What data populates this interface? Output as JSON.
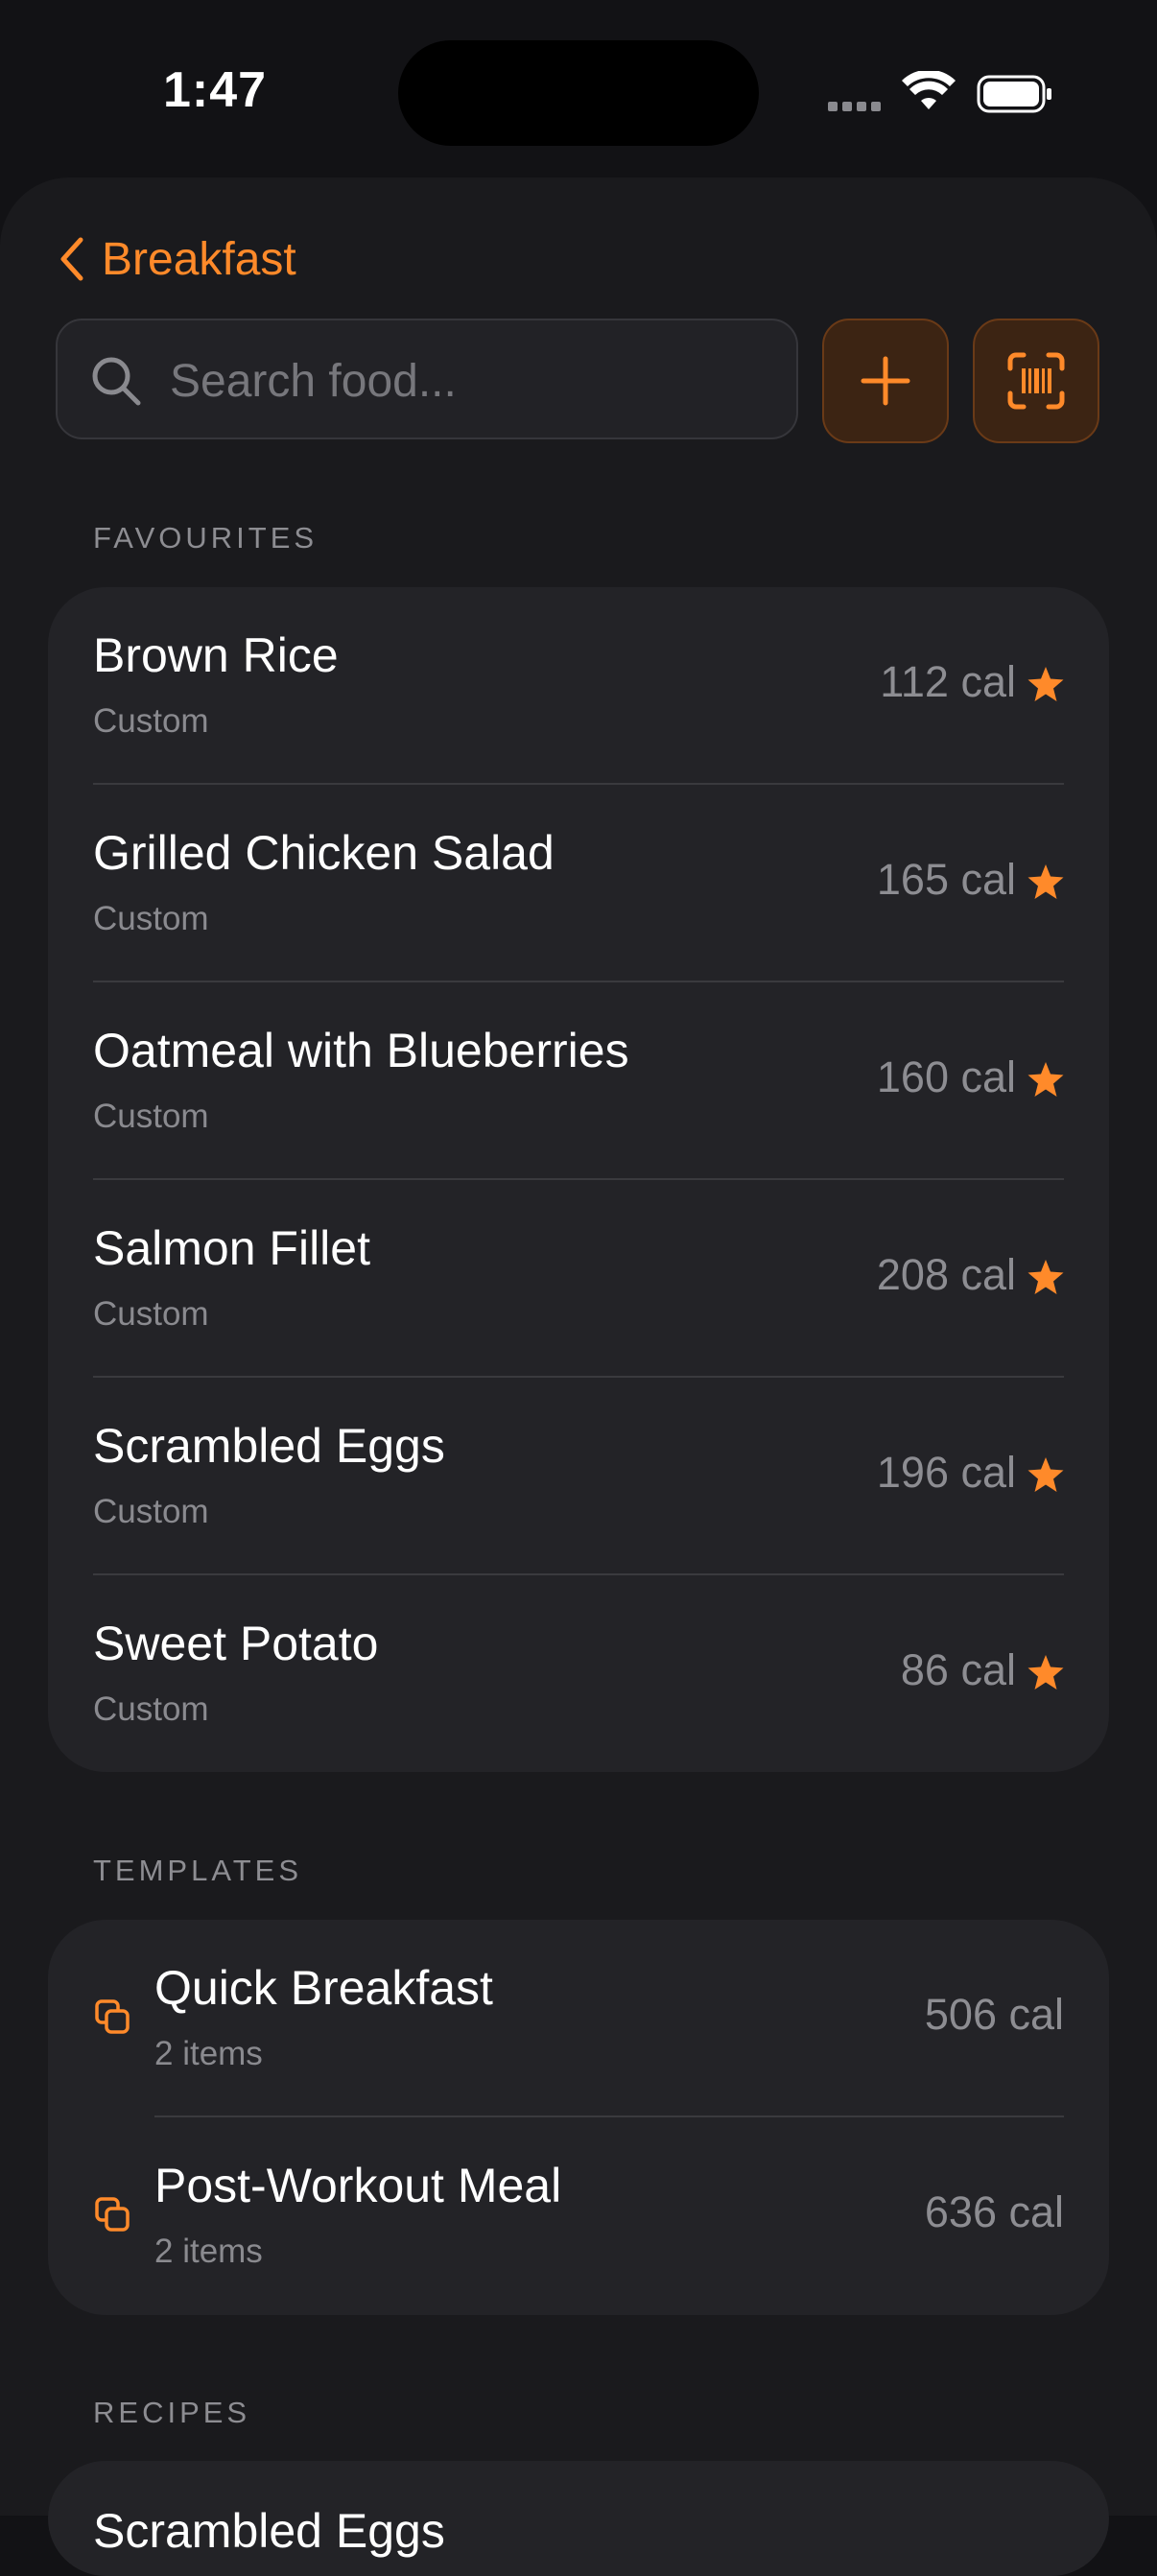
{
  "status_bar": {
    "time": "1:47"
  },
  "nav": {
    "back_label": "Breakfast"
  },
  "search": {
    "placeholder": "Search food..."
  },
  "favourites": {
    "title": "FAVOURITES",
    "items": [
      {
        "name": "Brown Rice",
        "source": "Custom",
        "calories": "112 cal"
      },
      {
        "name": "Grilled Chicken Salad",
        "source": "Custom",
        "calories": "165 cal"
      },
      {
        "name": "Oatmeal with Blueberries",
        "source": "Custom",
        "calories": "160 cal"
      },
      {
        "name": "Salmon Fillet",
        "source": "Custom",
        "calories": "208 cal"
      },
      {
        "name": "Scrambled Eggs",
        "source": "Custom",
        "calories": "196 cal"
      },
      {
        "name": "Sweet Potato",
        "source": "Custom",
        "calories": "86 cal"
      }
    ]
  },
  "templates": {
    "title": "TEMPLATES",
    "items": [
      {
        "name": "Quick Breakfast",
        "count": "2 items",
        "calories": "506 cal"
      },
      {
        "name": "Post-Workout Meal",
        "count": "2 items",
        "calories": "636 cal"
      }
    ]
  },
  "recipes": {
    "title": "RECIPES",
    "first_item_peek": "Scrambled Eggs"
  },
  "colors": {
    "accent": "#ff8a2a",
    "background": "#121215",
    "card": "#232327"
  },
  "icons": [
    "chevron-left-icon",
    "search-icon",
    "plus-icon",
    "barcode-scan-icon",
    "star-icon",
    "copy-icon",
    "wifi-icon",
    "battery-icon"
  ]
}
